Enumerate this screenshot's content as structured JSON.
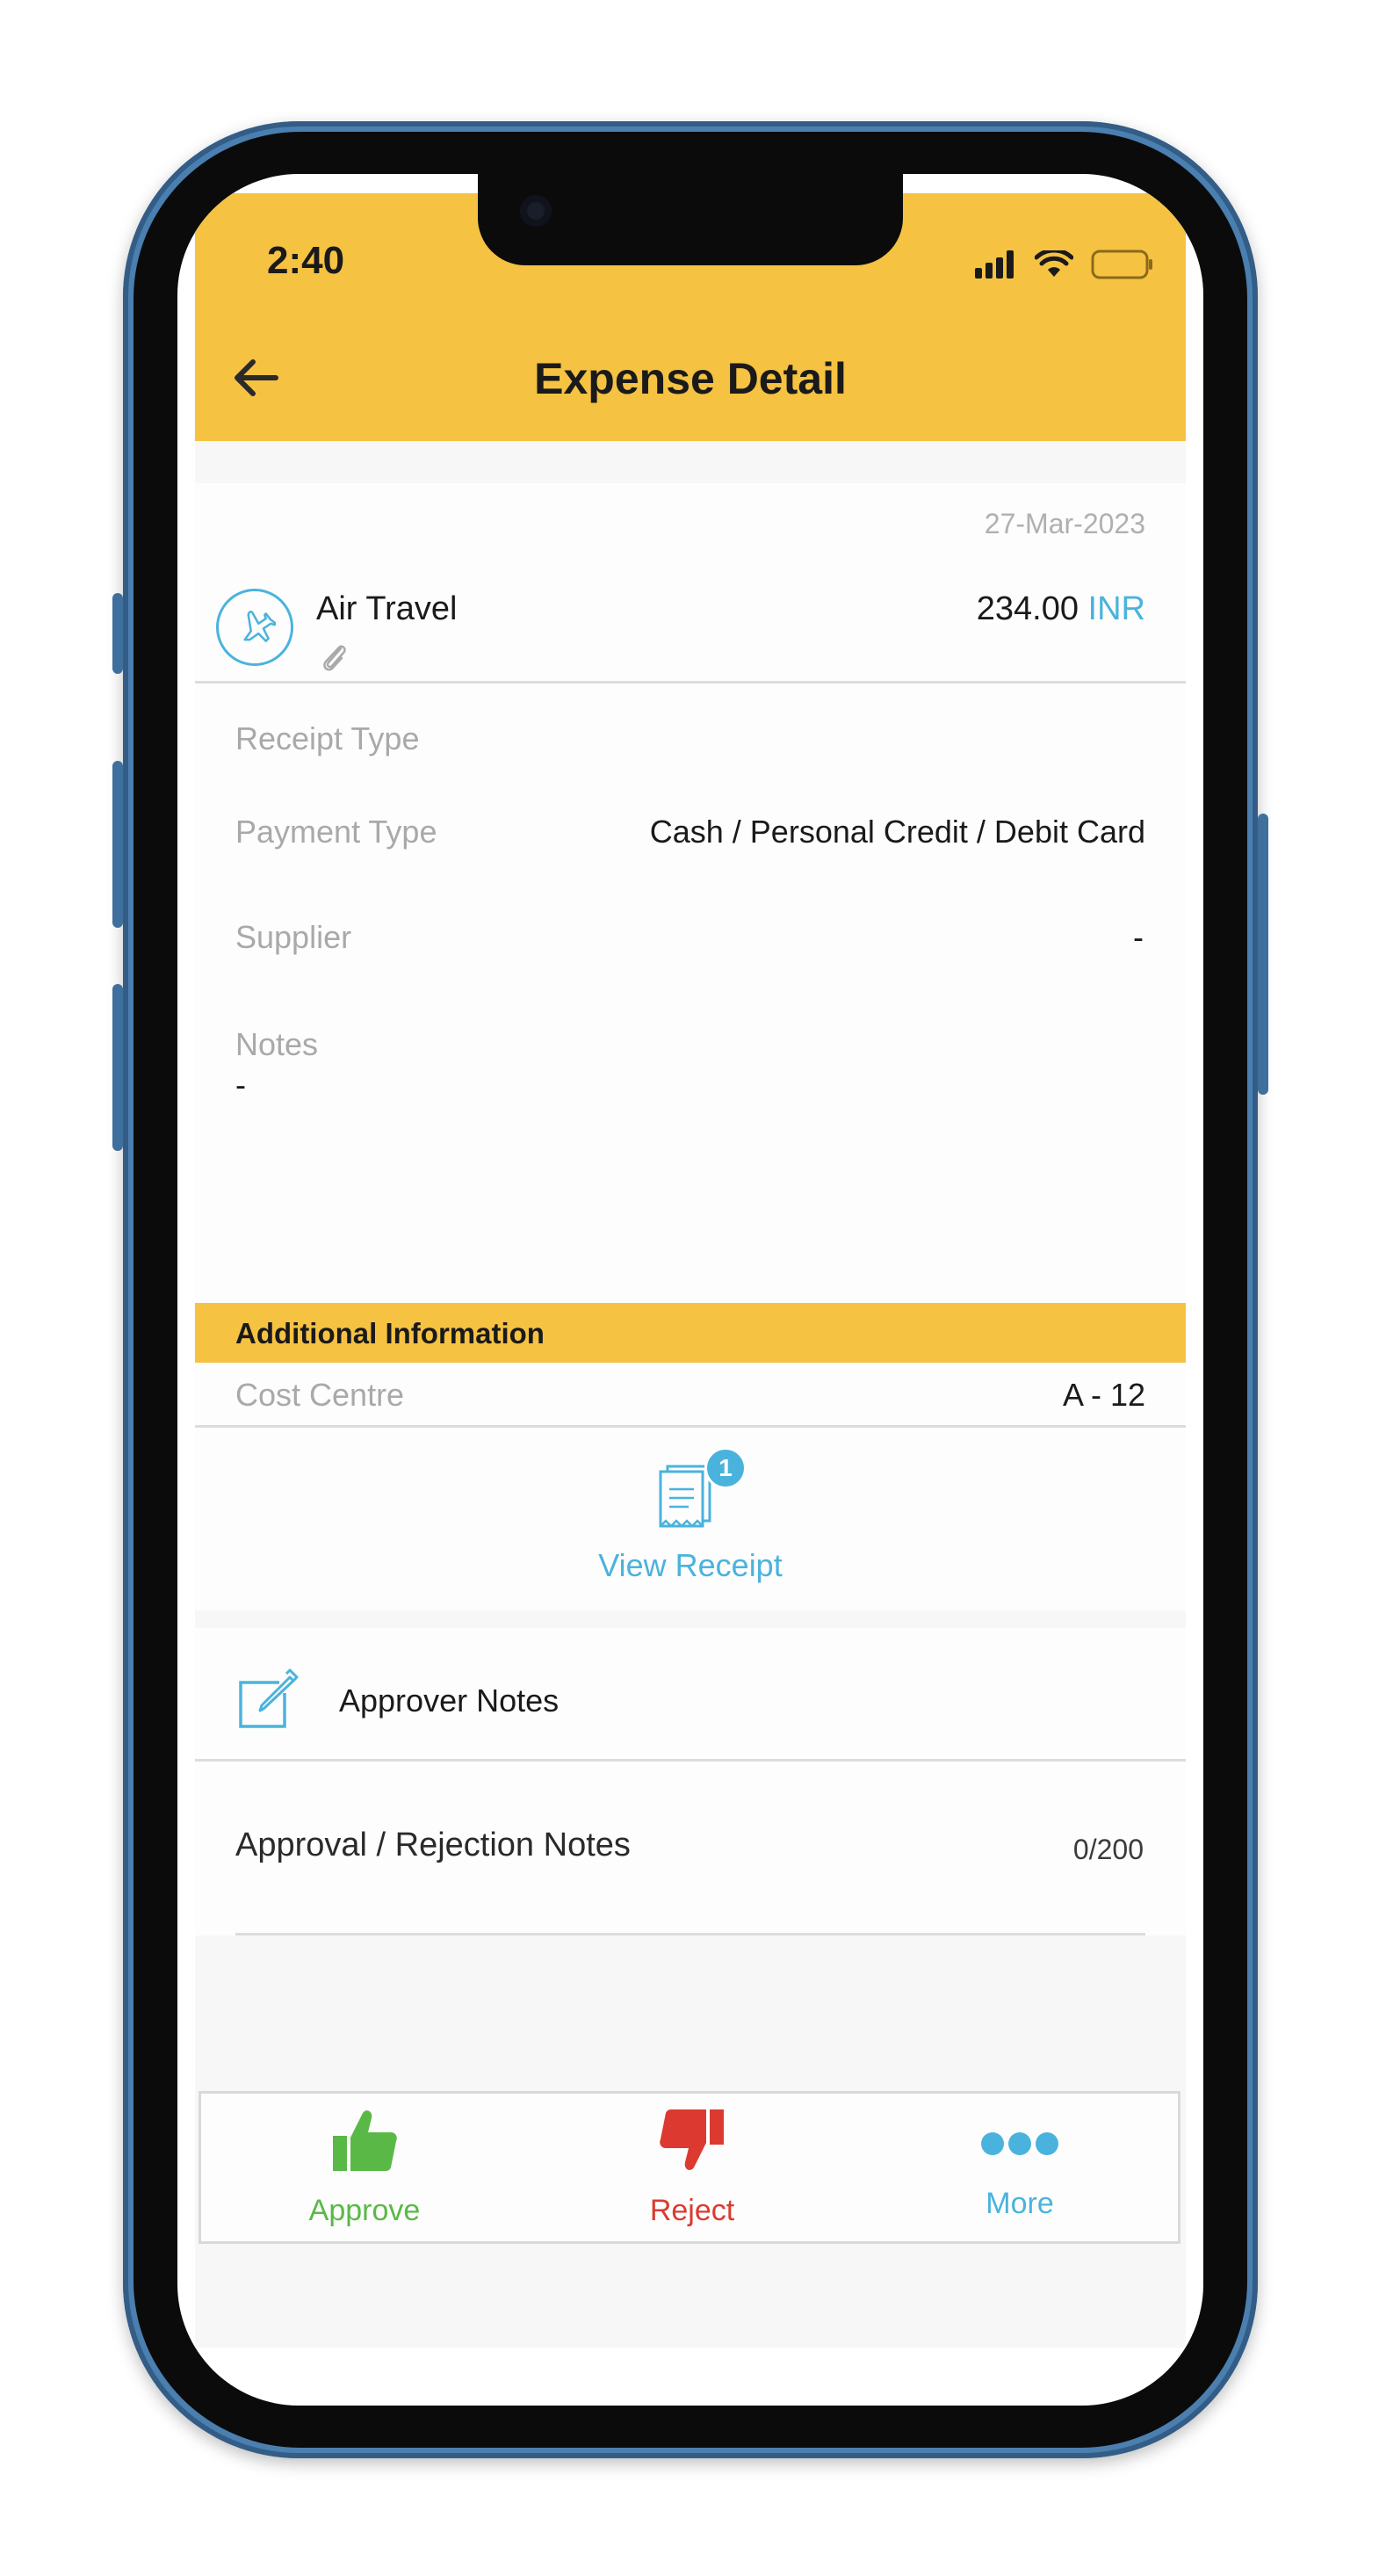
{
  "status_bar": {
    "time": "2:40"
  },
  "header": {
    "title": "Expense Detail"
  },
  "expense": {
    "date": "27-Mar-2023",
    "category": "Air Travel",
    "amount": "234.00",
    "currency": "INR"
  },
  "details": {
    "receipt_type_label": "Receipt Type",
    "payment_type_label": "Payment Type",
    "payment_type_value": "Cash / Personal Credit / Debit Card",
    "supplier_label": "Supplier",
    "supplier_value": "-",
    "notes_label": "Notes",
    "notes_value": "-"
  },
  "additional": {
    "title": "Additional Information",
    "cost_centre_label": "Cost Centre",
    "cost_centre_value": "A - 12"
  },
  "receipt": {
    "label": "View Receipt",
    "count": "1"
  },
  "approver": {
    "label": "Approver Notes",
    "input_label": "Approval / Rejection Notes",
    "counter": "0/200"
  },
  "actions": {
    "approve": "Approve",
    "reject": "Reject",
    "more": "More"
  },
  "colors": {
    "header": "#f5c242",
    "accent_blue": "#4ab3dd",
    "approve_green": "#5ab946",
    "reject_red": "#dc3a30"
  }
}
